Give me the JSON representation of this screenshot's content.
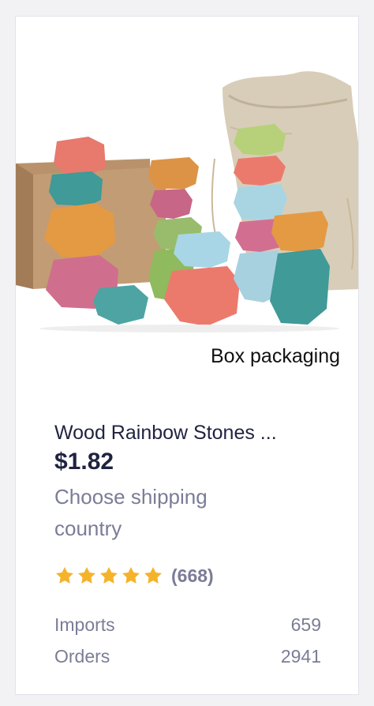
{
  "product": {
    "image_caption": "Box packaging",
    "title": "Wood Rainbow Stones ...",
    "price": "$1.82",
    "shipping_note": "Choose shipping country",
    "rating": {
      "stars": 5,
      "count_label": "(668)",
      "star_color": "#f5b32b"
    },
    "stats": [
      {
        "label": "Imports",
        "value": "659"
      },
      {
        "label": "Orders",
        "value": "2941"
      }
    ]
  }
}
